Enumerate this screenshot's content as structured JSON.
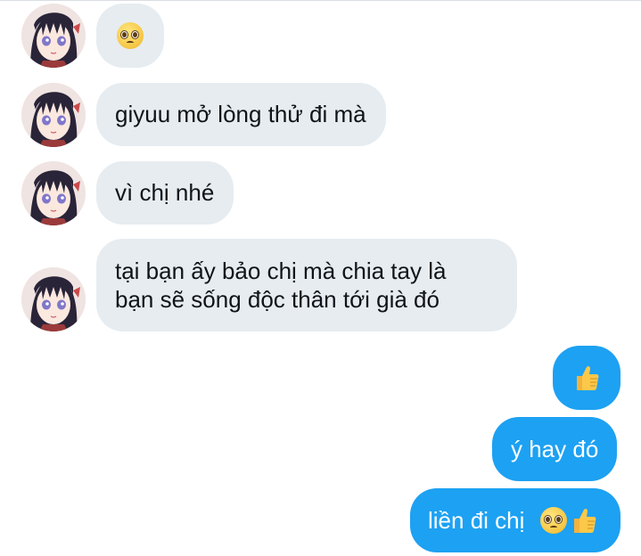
{
  "conversation": {
    "incoming": [
      {
        "text": "",
        "emoji": "pleading-face-icon"
      },
      {
        "text": "giyuu mở lòng thử đi mà"
      },
      {
        "text": "vì chị nhé"
      },
      {
        "line1": "tại bạn ấy bảo chị mà chia tay là",
        "line2": "bạn sẽ sống độc thân tới già đó"
      }
    ],
    "outgoing": [
      {
        "text": "",
        "emoji": "thumbs-up-icon"
      },
      {
        "text": "ý hay đó"
      },
      {
        "text": "liền đi chị",
        "emojis": [
          "pleading-face-icon",
          "thumbs-up-icon"
        ]
      }
    ]
  },
  "colors": {
    "incoming_bubble": "#e6ecf0",
    "outgoing_bubble": "#1da1f2",
    "incoming_text": "#0f1419",
    "outgoing_text": "#ffffff"
  }
}
